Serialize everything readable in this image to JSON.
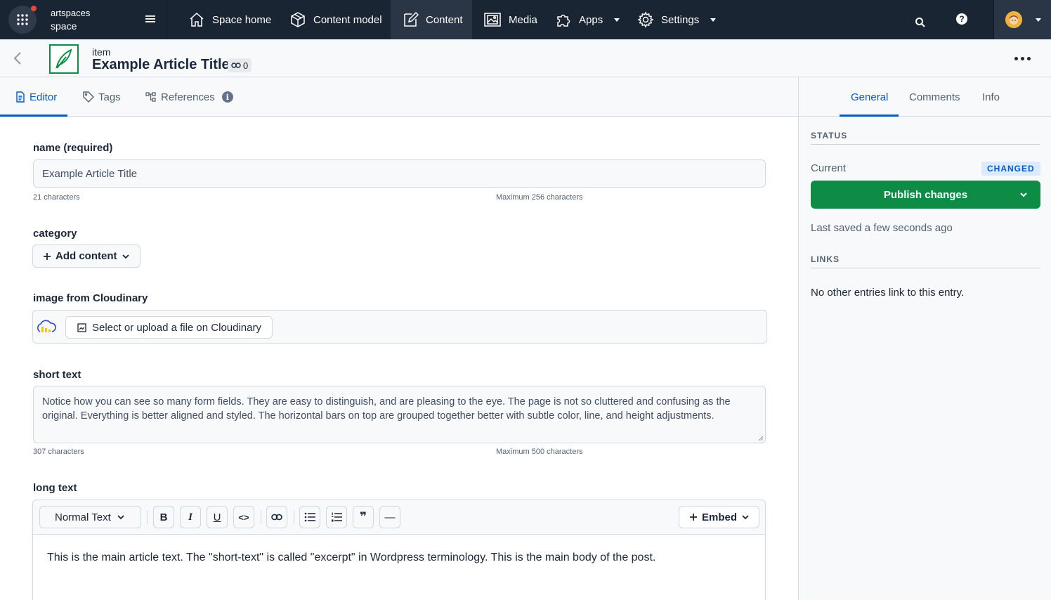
{
  "nav": {
    "space_org": "artspaces",
    "space_name": "space",
    "items": [
      {
        "label": "Space home",
        "icon": "home-icon"
      },
      {
        "label": "Content model",
        "icon": "cube-icon"
      },
      {
        "label": "Content",
        "icon": "edit-icon"
      },
      {
        "label": "Media",
        "icon": "media-icon"
      },
      {
        "label": "Apps",
        "icon": "puzzle-icon"
      },
      {
        "label": "Settings",
        "icon": "gear-icon"
      }
    ],
    "active": "Content",
    "help_glyph": "?"
  },
  "entry": {
    "content_type": "item",
    "title": "Example Article Title",
    "reference_count": "0"
  },
  "tabs": {
    "editor": "Editor",
    "tags": "Tags",
    "references": "References",
    "info_glyph": "i"
  },
  "sidebar": {
    "tabs": {
      "general": "General",
      "comments": "Comments",
      "info": "Info"
    },
    "status_title": "STATUS",
    "current_label": "Current",
    "status_badge": "CHANGED",
    "publish_label": "Publish changes",
    "last_saved": "Last saved a few seconds ago",
    "links_title": "LINKS",
    "links_text": "No other entries link to this entry."
  },
  "fields": {
    "name": {
      "label": "name (required)",
      "value": "Example Article Title",
      "count": "21 characters",
      "max": "Maximum 256 characters"
    },
    "category": {
      "label": "category",
      "button": "Add content"
    },
    "image": {
      "label": "image from Cloudinary",
      "button": "Select or upload a file on Cloudinary"
    },
    "short_text": {
      "label": "short text",
      "value": "Notice how you can see so many form fields. They are easy to distinguish, and are pleasing to the eye. The page is not so cluttered and confusing as the original. Everything is better aligned and styled. The horizontal bars on top are grouped together better with subtle color, line, and height adjustments.",
      "count": "307 characters",
      "max": "Maximum 500 characters"
    },
    "long_text": {
      "label": "long text",
      "format": "Normal Text",
      "embed": "Embed",
      "bold_glyph": "B",
      "italic_glyph": "I",
      "underline_glyph": "U",
      "code_glyph": "<>",
      "quote_glyph": "❞",
      "hr_glyph": "—",
      "body": "This is the main article text. The \"short-text\" is called \"excerpt\" in Wordpress terminology. This is the main body of the post."
    }
  },
  "colors": {
    "nav_bg": "#192532",
    "accent": "#0059c8",
    "publish_green": "#0e8c46",
    "notification_dot": "#e8473d"
  }
}
